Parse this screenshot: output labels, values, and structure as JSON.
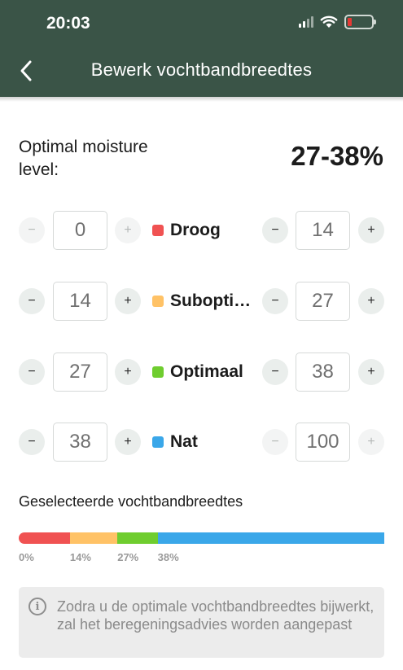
{
  "status": {
    "time": "20:03"
  },
  "header": {
    "title": "Bewerk vochtbandbreedtes"
  },
  "optimal": {
    "label": "Optimal moisture level:",
    "value": "27-38%"
  },
  "bands": [
    {
      "name": "Droog",
      "color": "#f05252",
      "min": "0",
      "max": "14",
      "min_dec_enabled": false,
      "min_inc_enabled": false,
      "max_dec_enabled": true,
      "max_inc_enabled": true
    },
    {
      "name": "Suboptimaal",
      "color": "#ffc266",
      "min": "14",
      "max": "27",
      "min_dec_enabled": true,
      "min_inc_enabled": true,
      "max_dec_enabled": true,
      "max_inc_enabled": true
    },
    {
      "name": "Optimaal",
      "color": "#6fcd2f",
      "min": "27",
      "max": "38",
      "min_dec_enabled": true,
      "min_inc_enabled": true,
      "max_dec_enabled": true,
      "max_inc_enabled": true
    },
    {
      "name": "Nat",
      "color": "#3aa7e9",
      "min": "38",
      "max": "100",
      "min_dec_enabled": true,
      "min_inc_enabled": true,
      "max_dec_enabled": false,
      "max_inc_enabled": false
    }
  ],
  "selected": {
    "title": "Geselecteerde vochtbandbreedtes",
    "ticks": [
      "0%",
      "14%",
      "27%",
      "38%"
    ]
  },
  "info": {
    "text": "Zodra u de optimale vochtbandbreedtes bijwerkt, zal het beregeningsadvies worden aangepast"
  },
  "buttons": {
    "minus": "−",
    "plus": "+"
  }
}
